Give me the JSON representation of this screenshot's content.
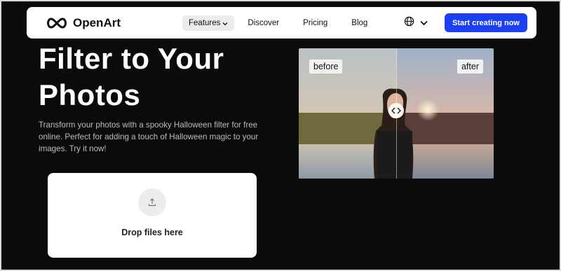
{
  "nav": {
    "logo_text": "OpenArt",
    "links": [
      {
        "label": "Features",
        "has_dropdown": true,
        "active": true
      },
      {
        "label": "Discover"
      },
      {
        "label": "Pricing"
      },
      {
        "label": "Blog"
      }
    ],
    "language_icon": "globe-icon",
    "cta_label": "Start creating now",
    "cta_color": "#1c3ff2"
  },
  "hero": {
    "title_line1": "Filter to Your",
    "title_line2": "Photos",
    "description": "Transform your photos with a spooky Halloween filter for free online. Perfect for adding a touch of Halloween magic to your images. Try it now!"
  },
  "upload": {
    "icon": "upload-icon",
    "label": "Drop files here"
  },
  "preview": {
    "before_label": "before",
    "after_label": "after",
    "slider_icon": "compare-arrows-icon"
  }
}
